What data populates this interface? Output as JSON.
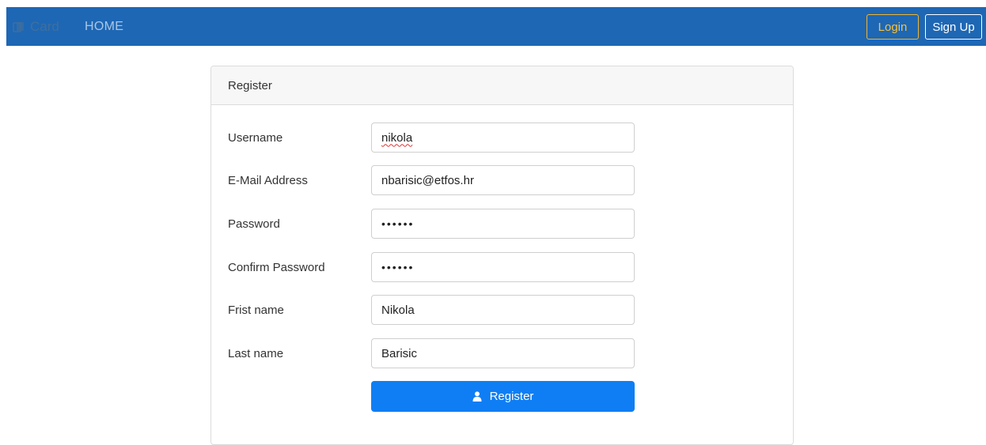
{
  "navbar": {
    "brand": "Card",
    "brand_icon": "cards-icon",
    "home_label": "HOME",
    "login_label": "Login",
    "signup_label": "Sign Up",
    "colors": {
      "bar": "#1e67b4",
      "login_border": "#f2b530"
    }
  },
  "card": {
    "title": "Register"
  },
  "form": {
    "fields": [
      {
        "label": "Username",
        "value": "nikola",
        "type": "text"
      },
      {
        "label": "E-Mail Address",
        "value": "nbarisic@etfos.hr",
        "type": "email"
      },
      {
        "label": "Password",
        "value": "••••••",
        "type": "password"
      },
      {
        "label": "Confirm Password",
        "value": "••••••",
        "type": "password"
      },
      {
        "label": "Frist name",
        "value": "Nikola",
        "type": "text"
      },
      {
        "label": "Last name",
        "value": "Barisic",
        "type": "text"
      }
    ],
    "submit_label": "Register",
    "submit_icon": "user-icon",
    "submit_color": "#0f7ef4"
  }
}
